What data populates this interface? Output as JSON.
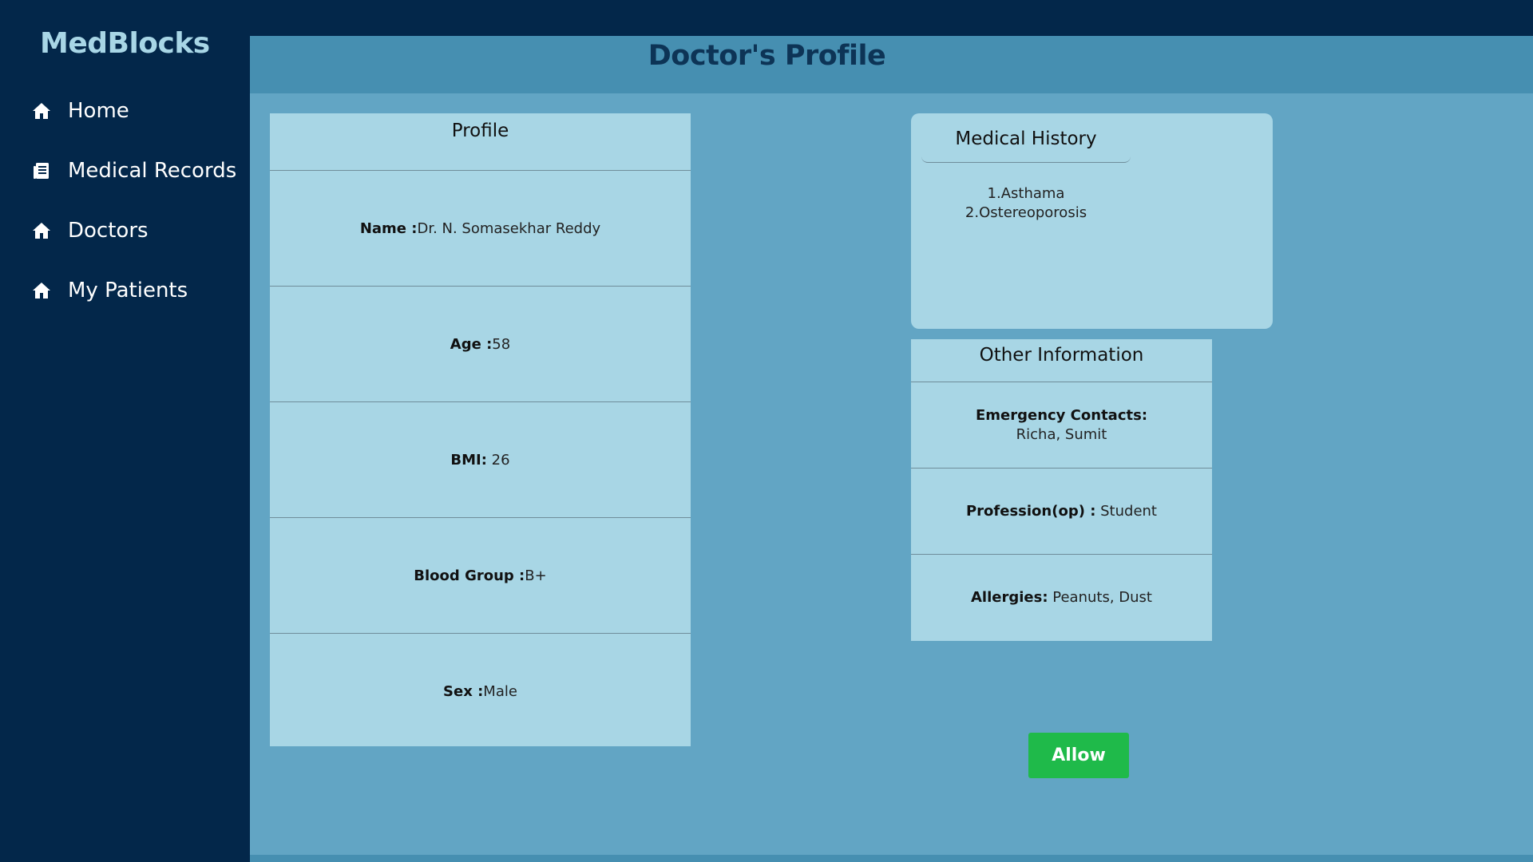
{
  "sidebar": {
    "brand": "MedBlocks",
    "items": [
      {
        "label": "Home",
        "icon": "home-icon"
      },
      {
        "label": "Medical Records",
        "icon": "records-icon"
      },
      {
        "label": "Doctors",
        "icon": "home-icon"
      },
      {
        "label": "My Patients",
        "icon": "home-icon"
      }
    ]
  },
  "header": {
    "title": "Doctor's Profile"
  },
  "profile": {
    "title": "Profile",
    "fields": [
      {
        "label": "Name :",
        "value": "Dr. N. Somasekhar Reddy"
      },
      {
        "label": "Age :",
        "value": "58"
      },
      {
        "label": "BMI:",
        "value": " 26"
      },
      {
        "label": "Blood Group :",
        "value": "B+"
      },
      {
        "label": "Sex :",
        "value": "Male"
      }
    ]
  },
  "medical_history": {
    "title": "Medical History",
    "items": [
      "1.Asthama",
      "2.Ostereoporosis"
    ]
  },
  "other_information": {
    "title": "Other Information",
    "emergency_label": "Emergency Contacts:",
    "emergency_value": "Richa, Sumit",
    "profession_label": "Profession(op) :",
    "profession_value": " Student",
    "allergies_label": "Allergies:",
    "allergies_value": " Peanuts, Dust"
  },
  "actions": {
    "allow_label": "Allow"
  },
  "colors": {
    "sidebar_bg": "#03274a",
    "main_bg": "#62a5c4",
    "header_bg": "#468fb1",
    "card_bg": "#a8d6e5",
    "allow_btn": "#1fba4a"
  }
}
